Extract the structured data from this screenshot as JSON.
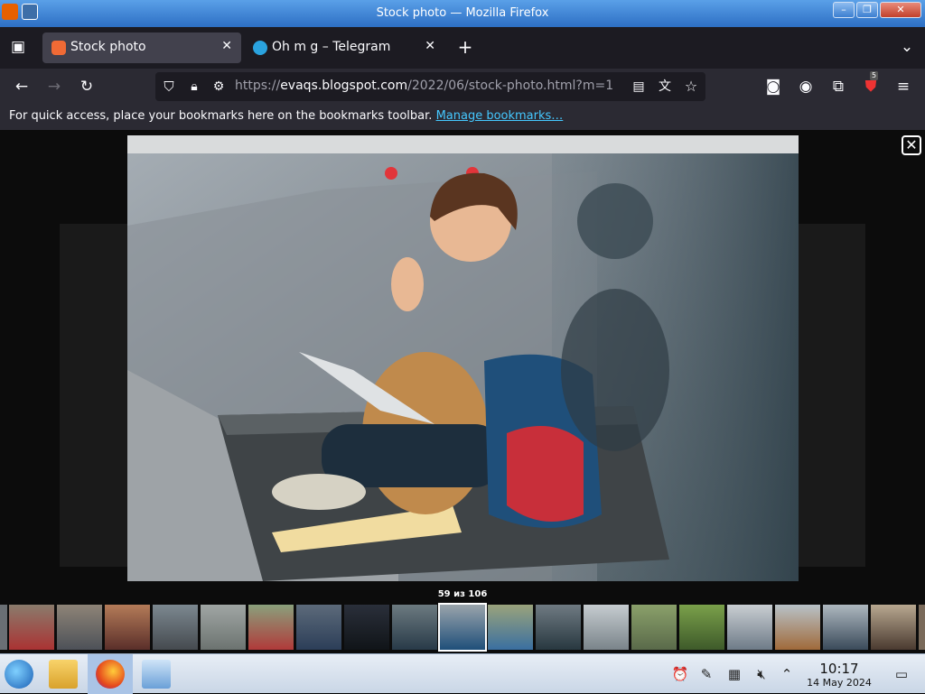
{
  "window": {
    "title": "Stock photo — Mozilla Firefox"
  },
  "tabs": [
    {
      "label": "Stock photo",
      "active": true,
      "favicon_color": "#f06a35"
    },
    {
      "label": "Oh m g – Telegram",
      "active": false,
      "favicon_color": "#2aa3df"
    }
  ],
  "url": {
    "host_prefix": "https://",
    "host": "evaqs.blogspot.com",
    "path": "/2022/06/stock-photo.html?m=1"
  },
  "bookmarks_bar": {
    "message": "For quick access, place your bookmarks here on the bookmarks toolbar. ",
    "link": "Manage bookmarks…"
  },
  "extensions": {
    "badge_count": "5"
  },
  "lightbox": {
    "counter": "59 из 106",
    "close_glyph": "✕"
  },
  "taskbar": {
    "time": "10:17",
    "date": "14 May 2024"
  },
  "colors": {
    "link": "#45c8ff",
    "accent_tab": "#42414d",
    "toolbar": "#2b2a33"
  }
}
